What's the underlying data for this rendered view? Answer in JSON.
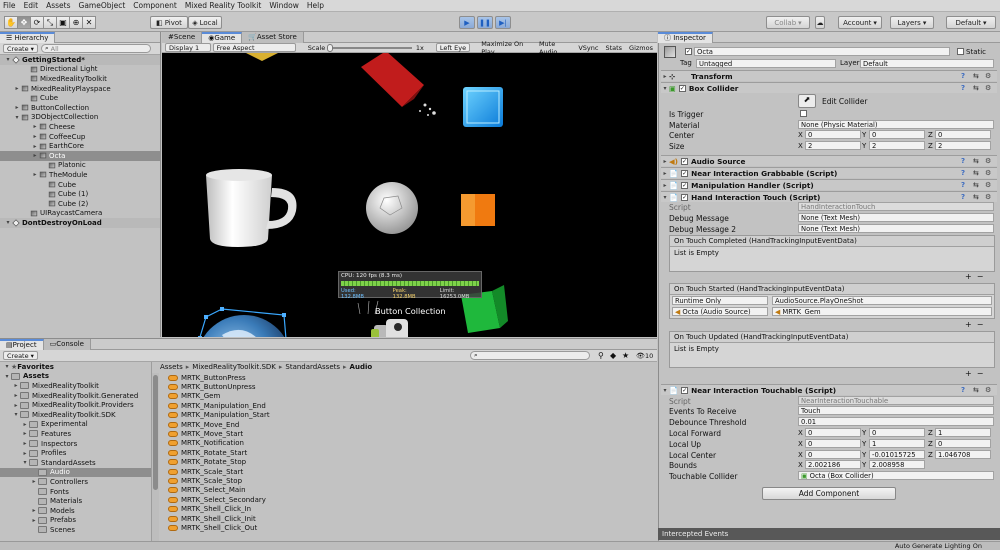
{
  "menu": [
    "File",
    "Edit",
    "Assets",
    "GameObject",
    "Component",
    "Mixed Reality Toolkit",
    "Window",
    "Help"
  ],
  "toolbar": {
    "pivot": "Pivot",
    "local": "Local",
    "collab": "Collab",
    "account": "Account",
    "layers": "Layers",
    "layout": "Default"
  },
  "hierarchy": {
    "tab": "Hierarchy",
    "create": "Create",
    "search": "All",
    "items": [
      {
        "label": "GettingStarted*",
        "indent": 0,
        "kind": "scene",
        "expanded": true
      },
      {
        "label": "Directional Light",
        "indent": 2,
        "kind": "cube"
      },
      {
        "label": "MixedRealityToolkit",
        "indent": 2,
        "kind": "cube"
      },
      {
        "label": "MixedRealityPlayspace",
        "indent": 1,
        "kind": "cube",
        "arrow": true
      },
      {
        "label": "Cube",
        "indent": 2,
        "kind": "cube"
      },
      {
        "label": "ButtonCollection",
        "indent": 1,
        "kind": "cube",
        "arrow": true
      },
      {
        "label": "3DObjectCollection",
        "indent": 1,
        "kind": "cube",
        "expanded": true
      },
      {
        "label": "Cheese",
        "indent": 3,
        "kind": "cube",
        "arrow": true
      },
      {
        "label": "CoffeeCup",
        "indent": 3,
        "kind": "cube",
        "arrow": true
      },
      {
        "label": "EarthCore",
        "indent": 3,
        "kind": "cube",
        "arrow": true
      },
      {
        "label": "Octa",
        "indent": 3,
        "kind": "cube",
        "selected": true,
        "arrow": true
      },
      {
        "label": "Platonic",
        "indent": 4,
        "kind": "cube"
      },
      {
        "label": "TheModule",
        "indent": 3,
        "kind": "cube",
        "arrow": true
      },
      {
        "label": "Cube",
        "indent": 4,
        "kind": "cube"
      },
      {
        "label": "Cube (1)",
        "indent": 4,
        "kind": "cube"
      },
      {
        "label": "Cube (2)",
        "indent": 4,
        "kind": "cube"
      },
      {
        "label": "UIRaycastCamera",
        "indent": 2,
        "kind": "cube"
      },
      {
        "label": "DontDestroyOnLoad",
        "indent": 0,
        "kind": "scene",
        "expanded": true
      }
    ]
  },
  "view": {
    "tabs": [
      "Scene",
      "Game",
      "Asset Store"
    ],
    "display": "Display 1",
    "aspect": "Free Aspect",
    "scale_label": "Scale",
    "scale_value": "1x",
    "eye": "Left Eye",
    "opts": [
      "Maximize On Play",
      "Mute Audio",
      "VSync",
      "Stats",
      "Gizmos"
    ],
    "stats": {
      "cpu": "CPU: 120 fps (8.3 ms)",
      "used": "Used: 132.8MB",
      "peak": "Peak: 132.8MB",
      "limit": "Limit: 16253.0MB"
    },
    "button_collection": "Button Collection"
  },
  "project": {
    "tabs": [
      "Project",
      "Console"
    ],
    "create": "Create",
    "slider_val": "10",
    "tree": [
      {
        "label": "Favorites",
        "indent": 0,
        "kind": "fav",
        "expanded": true
      },
      {
        "label": "Assets",
        "indent": 0,
        "kind": "folder",
        "expanded": true
      },
      {
        "label": "MixedRealityToolkit",
        "indent": 1,
        "kind": "folder",
        "arrow": true
      },
      {
        "label": "MixedRealityToolkit.Generated",
        "indent": 1,
        "kind": "folder",
        "arrow": true
      },
      {
        "label": "MixedRealityToolkit.Providers",
        "indent": 1,
        "kind": "folder",
        "arrow": true
      },
      {
        "label": "MixedRealityToolkit.SDK",
        "indent": 1,
        "kind": "folder",
        "expanded": true
      },
      {
        "label": "Experimental",
        "indent": 2,
        "kind": "folder",
        "arrow": true
      },
      {
        "label": "Features",
        "indent": 2,
        "kind": "folder",
        "arrow": true
      },
      {
        "label": "Inspectors",
        "indent": 2,
        "kind": "folder",
        "arrow": true
      },
      {
        "label": "Profiles",
        "indent": 2,
        "kind": "folder",
        "arrow": true
      },
      {
        "label": "StandardAssets",
        "indent": 2,
        "kind": "folder",
        "expanded": true
      },
      {
        "label": "Audio",
        "indent": 3,
        "kind": "folder",
        "selected": true
      },
      {
        "label": "Controllers",
        "indent": 3,
        "kind": "folder",
        "arrow": true
      },
      {
        "label": "Fonts",
        "indent": 3,
        "kind": "folder"
      },
      {
        "label": "Materials",
        "indent": 3,
        "kind": "folder"
      },
      {
        "label": "Models",
        "indent": 3,
        "kind": "folder",
        "arrow": true
      },
      {
        "label": "Prefabs",
        "indent": 3,
        "kind": "folder",
        "arrow": true
      },
      {
        "label": "Scenes",
        "indent": 3,
        "kind": "folder"
      }
    ],
    "breadcrumb": [
      "Assets",
      "MixedRealityToolkit.SDK",
      "StandardAssets",
      "Audio"
    ],
    "files": [
      "MRTK_ButtonPress",
      "MRTK_ButtonUnpress",
      "MRTK_Gem",
      "MRTK_Manipulation_End",
      "MRTK_Manipulation_Start",
      "MRTK_Move_End",
      "MRTK_Move_Start",
      "MRTK_Notification",
      "MRTK_Rotate_Start",
      "MRTK_Rotate_Stop",
      "MRTK_Scale_Start",
      "MRTK_Scale_Stop",
      "MRTK_Select_Main",
      "MRTK_Select_Secondary",
      "MRTK_Shell_Click_In",
      "MRTK_Shell_Click_Init",
      "MRTK_Shell_Click_Out"
    ]
  },
  "inspector": {
    "tab": "Inspector",
    "name": "Octa",
    "static": "Static",
    "tag_label": "Tag",
    "tag": "Untagged",
    "layer_label": "Layer",
    "layer": "Default",
    "transform": "Transform",
    "box": {
      "title": "Box Collider",
      "edit": "Edit Collider",
      "is_trigger": "Is Trigger",
      "material": "Material",
      "material_val": "None (Physic Material)",
      "center": "Center",
      "size": "Size",
      "cx": "0",
      "cy": "0",
      "cz": "0",
      "sx": "2",
      "sy": "2",
      "sz": "2"
    },
    "audio": "Audio Source",
    "grab": "Near Interaction Grabbable (Script)",
    "manip": "Manipulation Handler (Script)",
    "hand": {
      "title": "Hand Interaction Touch (Script)",
      "script": "Script",
      "script_val": "HandInteractionTouch",
      "debug1": "Debug Message",
      "debug1_val": "None (Text Mesh)",
      "debug2": "Debug Message 2",
      "debug2_val": "None (Text Mesh)",
      "ev1": "On Touch Completed (HandTrackingInputEventData)",
      "empty": "List is Empty",
      "ev2": "On Touch Started (HandTrackingInputEventData)",
      "runtime": "Runtime Only",
      "func": "AudioSource.PlayOneShot",
      "obj": "Octa (Audio Source)",
      "clip": "MRTK_Gem",
      "ev3": "On Touch Updated (HandTrackingInputEventData)"
    },
    "touchable": {
      "title": "Near Interaction Touchable (Script)",
      "script": "Script",
      "script_val": "NearInteractionTouchable",
      "events": "Events To Receive",
      "events_val": "Touch",
      "debounce": "Debounce Threshold",
      "debounce_val": "0.01",
      "fwd": "Local Forward",
      "up": "Local Up",
      "center": "Local Center",
      "bounds": "Bounds",
      "collider": "Touchable Collider",
      "collider_val": "Octa (Box Collider)",
      "fx": "0",
      "fy": "0",
      "fz": "1",
      "ux": "0",
      "uy": "1",
      "uz": "0",
      "ccx": "0",
      "ccy": "-0.01015725",
      "ccz": "1.046708",
      "bx": "2.002186",
      "by": "2.008958"
    },
    "add": "Add Component",
    "intercepted": "Intercepted Events"
  },
  "status": "Auto Generate Lighting On"
}
